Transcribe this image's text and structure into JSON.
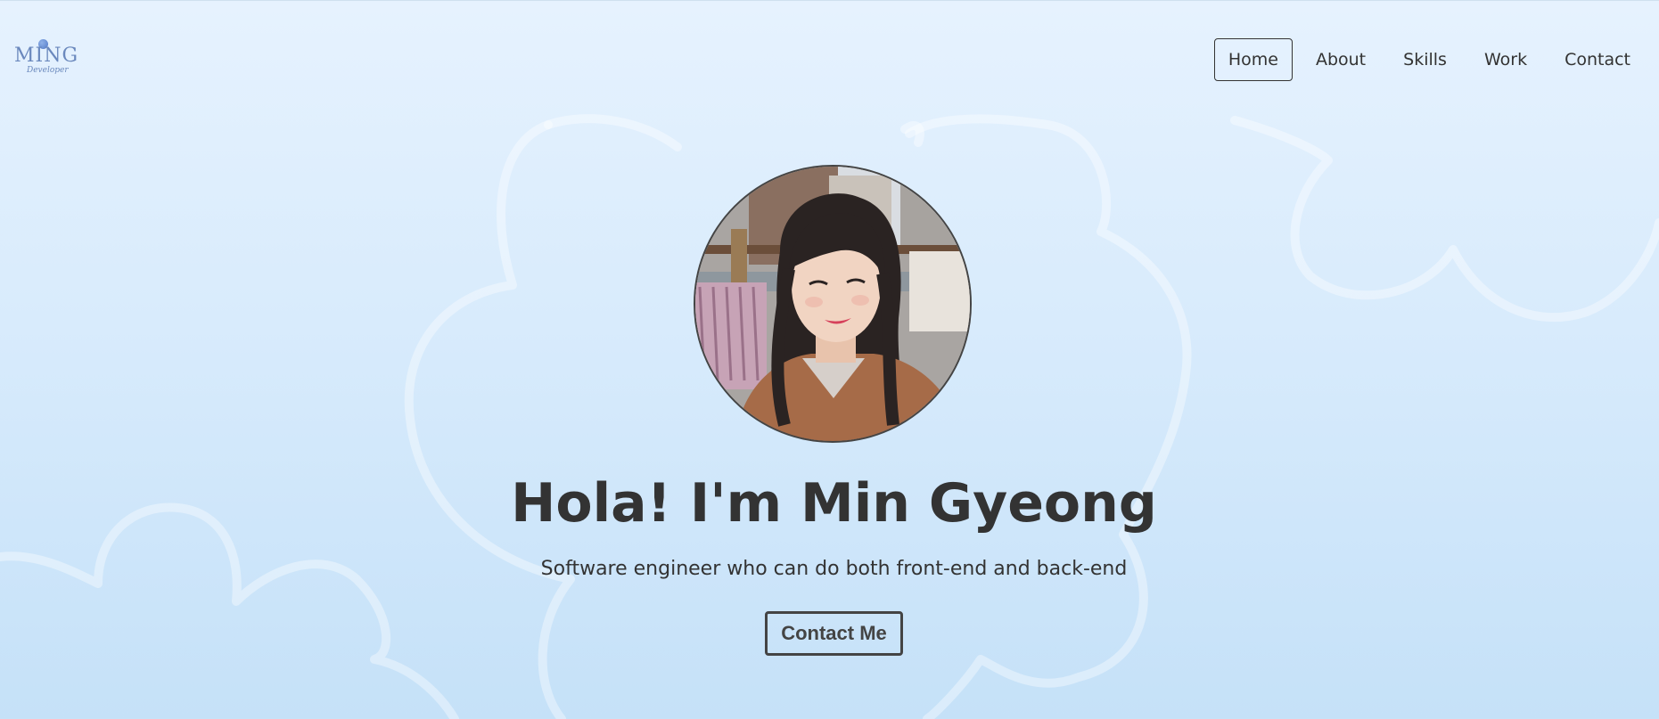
{
  "logo": {
    "text": "MING",
    "subtext": "Developer"
  },
  "nav": {
    "items": [
      "Home",
      "About",
      "Skills",
      "Work",
      "Contact"
    ],
    "active": "Home"
  },
  "hero": {
    "title": "Hola! I'm Min Gyeong",
    "subtitle": "Software engineer who can do both front-end and back-end",
    "cta_label": "Contact Me"
  },
  "colors": {
    "text": "#333333",
    "background_top": "#e6f2fe",
    "background_bottom": "#c5e1f8",
    "logo": "#6a88bd"
  },
  "icons": [
    "logo-dot-icon",
    "cloud-shapes"
  ]
}
